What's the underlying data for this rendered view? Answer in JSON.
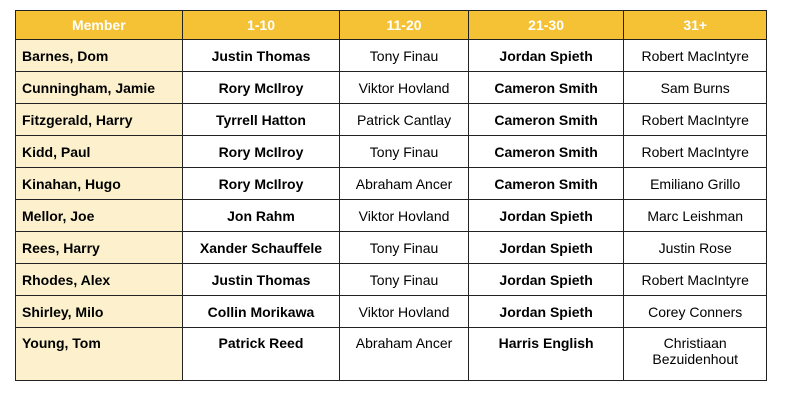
{
  "colors": {
    "header_bg": "#f4c234",
    "header_text": "#ffffff",
    "member_bg": "#fcf1cc",
    "border": "#222222"
  },
  "headers": [
    "Member",
    "1-10",
    "11-20",
    "21-30",
    "31+"
  ],
  "rows": [
    [
      "Barnes, Dom",
      "Justin Thomas",
      "Tony Finau",
      "Jordan Spieth",
      "Robert MacIntyre"
    ],
    [
      "Cunningham, Jamie",
      "Rory McIlroy",
      "Viktor Hovland",
      "Cameron Smith",
      "Sam Burns"
    ],
    [
      "Fitzgerald, Harry",
      "Tyrrell Hatton",
      "Patrick Cantlay",
      "Cameron Smith",
      "Robert MacIntyre"
    ],
    [
      "Kidd, Paul",
      "Rory McIlroy",
      "Tony Finau",
      "Cameron Smith",
      "Robert MacIntyre"
    ],
    [
      "Kinahan, Hugo",
      "Rory McIlroy",
      "Abraham Ancer",
      "Cameron Smith",
      "Emiliano Grillo"
    ],
    [
      "Mellor, Joe",
      "Jon Rahm",
      "Viktor Hovland",
      "Jordan Spieth",
      "Marc Leishman"
    ],
    [
      "Rees, Harry",
      "Xander Schauffele",
      "Tony Finau",
      "Jordan Spieth",
      "Justin Rose"
    ],
    [
      "Rhodes, Alex",
      "Justin Thomas",
      "Tony Finau",
      "Jordan Spieth",
      "Robert MacIntyre"
    ],
    [
      "Shirley, Milo",
      "Collin Morikawa",
      "Viktor Hovland",
      "Jordan Spieth",
      "Corey Conners"
    ],
    [
      "Young, Tom",
      "Patrick Reed",
      "Abraham Ancer",
      "Harris English",
      "Christiaan Bezuidenhout"
    ]
  ]
}
